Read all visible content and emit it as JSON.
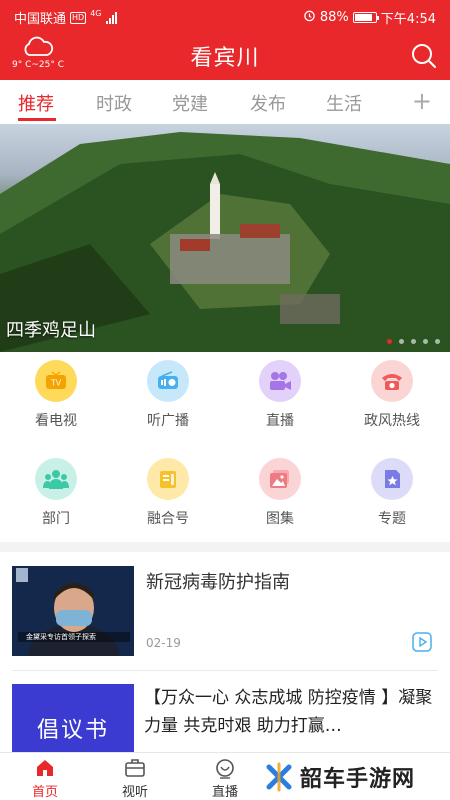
{
  "status_bar": {
    "carrier": "中国联通",
    "network_badge": "HD",
    "network_type": "4G",
    "battery": "88%",
    "battery_level": 0.88,
    "time": "下午4:54"
  },
  "header": {
    "title": "看宾川",
    "weather_temp": "9° C~25° C",
    "weather_icon": "cloud-icon",
    "search_icon": "search-icon"
  },
  "tabs": [
    {
      "label": "推荐",
      "active": true
    },
    {
      "label": "时政"
    },
    {
      "label": "党建"
    },
    {
      "label": "发布"
    },
    {
      "label": "生活"
    }
  ],
  "tabs_add_label": "+",
  "banner": {
    "caption": "四季鸡足山",
    "dot_count": 5,
    "active_dot": 0
  },
  "grid": [
    {
      "label": "看电视",
      "icon": "tv-icon",
      "color": "#ffd95a",
      "icon_color": "#f4b400"
    },
    {
      "label": "听广播",
      "icon": "radio-icon",
      "color": "#c7e7fb",
      "icon_color": "#46b0ef"
    },
    {
      "label": "直播",
      "icon": "camera-icon",
      "color": "#e2d1f8",
      "icon_color": "#a575e6"
    },
    {
      "label": "政风热线",
      "icon": "phone-icon",
      "color": "#fbd4d4",
      "icon_color": "#ee5b5b"
    },
    {
      "label": "部门",
      "icon": "people-icon",
      "color": "#c9f0e6",
      "icon_color": "#3ccaa6"
    },
    {
      "label": "融合号",
      "icon": "media-icon",
      "color": "#ffe9a8",
      "icon_color": "#f7c12b"
    },
    {
      "label": "图集",
      "icon": "gallery-icon",
      "color": "#fbd4d6",
      "icon_color": "#f07a82"
    },
    {
      "label": "专题",
      "icon": "topic-icon",
      "color": "#dcdcf8",
      "icon_color": "#7b7be6"
    }
  ],
  "news": [
    {
      "title": "新冠病毒防护指南",
      "date": "02-19",
      "thumb_caption": "金黛采专访首领子探索"
    },
    {
      "title": "【万众一心 众志成城 防控疫情 】凝聚力量 共克时艰 助力打赢…",
      "thumb_text": "倡议书"
    }
  ],
  "bottom_nav": [
    {
      "label": "首页",
      "icon": "home-icon",
      "active": true
    },
    {
      "label": "视听",
      "icon": "tv-briefcase-icon"
    },
    {
      "label": "直播",
      "icon": "live-icon"
    }
  ],
  "watermark": {
    "text": "韶车手游网"
  },
  "colors": {
    "brand_red": "#e8282a"
  }
}
